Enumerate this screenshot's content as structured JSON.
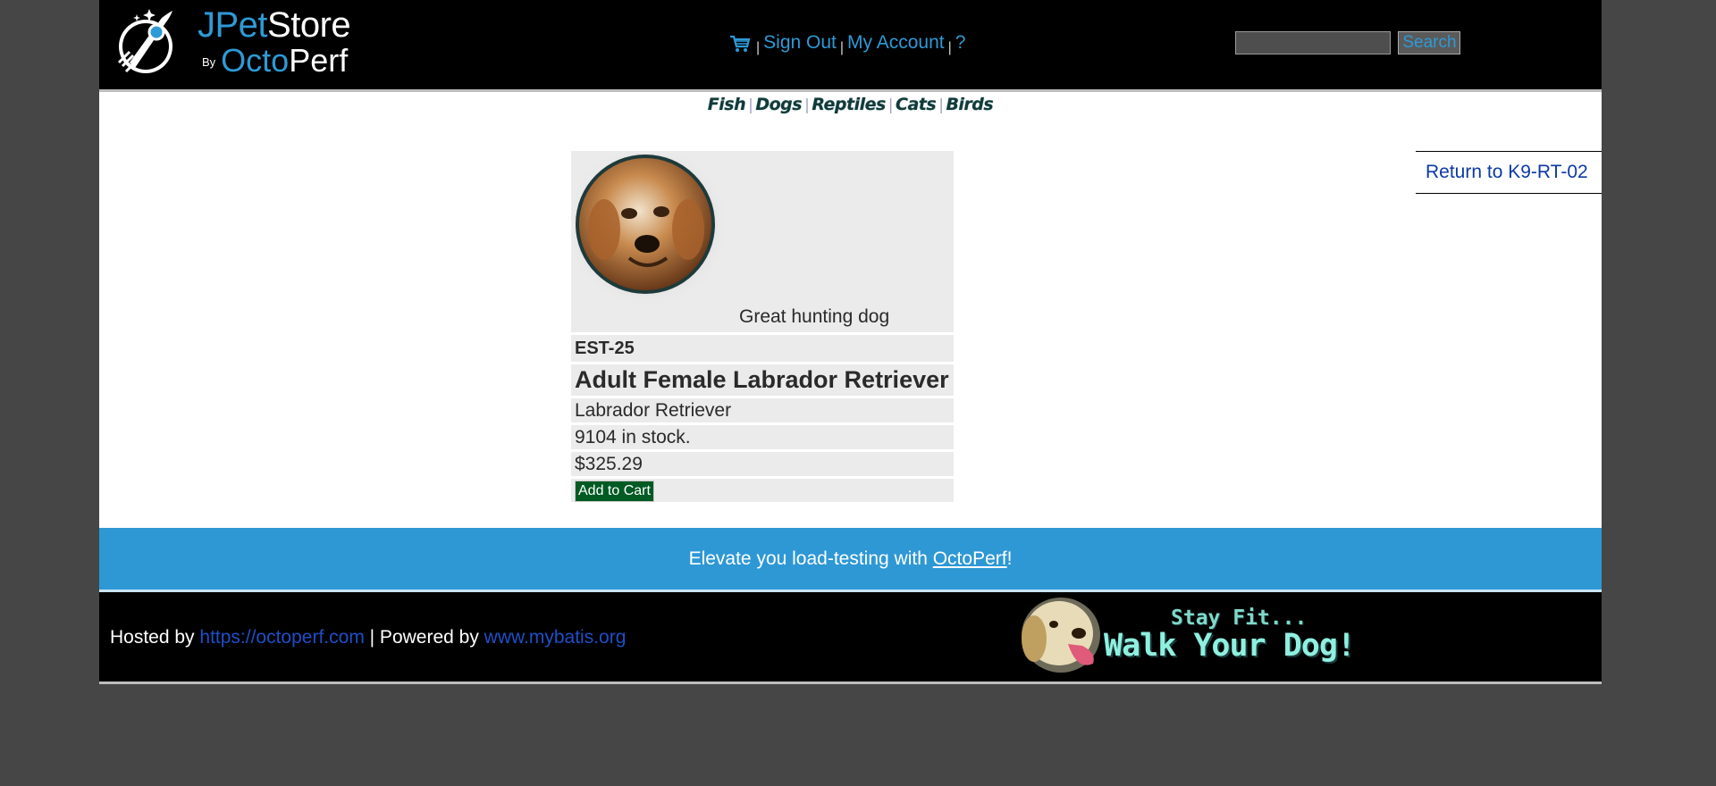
{
  "header": {
    "logo": {
      "brand_primary": "JPet",
      "brand_secondary": "Store",
      "by": "By",
      "company_primary": "Octo",
      "company_secondary": "Perf"
    },
    "menu": {
      "cart_icon": "shopping-cart-icon",
      "sign_out": "Sign Out",
      "my_account": "My Account",
      "help": "?"
    },
    "search": {
      "value": "",
      "button_label": "Search"
    }
  },
  "quicklinks": [
    "Fish",
    "Dogs",
    "Reptiles",
    "Cats",
    "Birds"
  ],
  "back_link": "Return to K9-RT-02",
  "item": {
    "description": "Great hunting dog",
    "id": "EST-25",
    "name": "Adult Female Labrador Retriever",
    "product": "Labrador Retriever",
    "stock": "9104 in stock.",
    "price": "$325.29",
    "add_to_cart": "Add to Cart"
  },
  "band": {
    "text_before": "Elevate you load-testing with ",
    "link": "OctoPerf",
    "text_after": "!"
  },
  "footer": {
    "hosted_by": "Hosted by ",
    "hosted_link": "https://octoperf.com",
    "powered_by": " | Powered by ",
    "powered_link": "www.mybatis.org",
    "banner_line1": "Stay Fit...",
    "banner_line2": "Walk Your Dog!"
  },
  "colors": {
    "page_background": "#464646",
    "header_background": "#000000",
    "link_blue": "#2e9ad6",
    "band_blue": "#2e98d5",
    "add_to_cart_green": "#005a23",
    "return_link": "#0b3aa6"
  }
}
